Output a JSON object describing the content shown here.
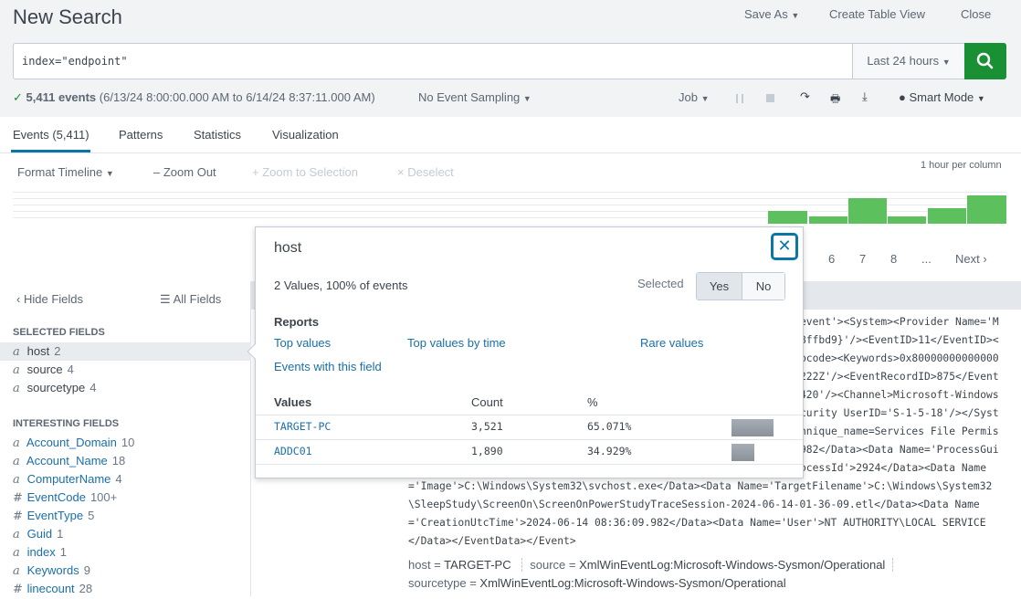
{
  "header": {
    "title": "New Search",
    "save_as": "Save As",
    "create_table_view": "Create Table View",
    "close": "Close"
  },
  "search": {
    "query": "index=\"endpoint\"",
    "time_range": "Last 24 hours",
    "search_icon": "magnifier-icon",
    "button_color": "#1a9035"
  },
  "status": {
    "check": "✓",
    "count": "5,411 events",
    "range": "(6/13/24 8:00:00.000 AM to 6/14/24 8:37:11.000 AM)",
    "sampling": "No Event Sampling",
    "job": "Job",
    "mode": "Smart Mode"
  },
  "tabs": [
    {
      "label": "Events (5,411)",
      "active": true
    },
    {
      "label": "Patterns"
    },
    {
      "label": "Statistics"
    },
    {
      "label": "Visualization"
    }
  ],
  "timeline": {
    "format": "Format Timeline",
    "zoom_out": "Zoom Out",
    "zoom_selection": "Zoom to Selection",
    "deselect": "Deselect",
    "scale": "1 hour per column",
    "bar_color": "#5cc05c",
    "relative_bars": [
      14,
      8,
      28,
      8,
      17,
      31
    ]
  },
  "pagination": {
    "pages": [
      "6",
      "7",
      "8",
      "..."
    ],
    "next": "Next"
  },
  "sidebar": {
    "hide_fields": "Hide Fields",
    "all_fields": "All Fields",
    "selected_title": "SELECTED FIELDS",
    "selected": [
      {
        "type": "a",
        "name": "host",
        "count": "2"
      },
      {
        "type": "a",
        "name": "source",
        "count": "4"
      },
      {
        "type": "a",
        "name": "sourcetype",
        "count": "4"
      }
    ],
    "interesting_title": "INTERESTING FIELDS",
    "interesting": [
      {
        "type": "a",
        "name": "Account_Domain",
        "count": "10"
      },
      {
        "type": "a",
        "name": "Account_Name",
        "count": "18"
      },
      {
        "type": "a",
        "name": "ComputerName",
        "count": "4"
      },
      {
        "type": "#",
        "name": "EventCode",
        "count": "100+"
      },
      {
        "type": "#",
        "name": "EventType",
        "count": "5"
      },
      {
        "type": "a",
        "name": "Guid",
        "count": "1"
      },
      {
        "type": "a",
        "name": "index",
        "count": "1"
      },
      {
        "type": "a",
        "name": "Keywords",
        "count": "9"
      },
      {
        "type": "#",
        "name": "linecount",
        "count": "28"
      }
    ]
  },
  "event": {
    "partial_lines": [
      "event'><System><Provider Name='M",
      "8ffbd9}'/><EventID>11</EventID><",
      "pcode><Keywords>0x80000000000000",
      "222Z'/><EventRecordID>875</Event",
      "420'/><Channel>Microsoft-Windows",
      "curity UserID='S-1-5-18'/></Syst",
      "hnique_name=Services File Permis",
      "982</Data><Data Name='ProcessGui",
      "ocessId'>2924</Data><Data Name"
    ],
    "lines": [
      "='Image'>C:\\Windows\\System32\\svchost.exe</Data><Data Name='TargetFilename'>C:\\Windows\\System32",
      "\\SleepStudy\\ScreenOn\\ScreenOnPowerStudyTraceSession-2024-06-14-01-36-09.etl</Data><Data Name",
      "='CreationUtcTime'>2024-06-14 08:36:09.982</Data><Data Name='User'>NT AUTHORITY\\LOCAL SERVICE",
      "</Data></EventData></Event>"
    ],
    "host_key": "host =",
    "host": "TARGET-PC",
    "source_key": "source =",
    "source": "XmlWinEventLog:Microsoft-Windows-Sysmon/Operational",
    "sourcetype_key": "sourcetype =",
    "sourcetype": "XmlWinEventLog:Microsoft-Windows-Sysmon/Operational"
  },
  "popup": {
    "title": "host",
    "summary": "2 Values, 100% of events",
    "selected_label": "Selected",
    "yes": "Yes",
    "no": "No",
    "selected_value": "Yes",
    "reports_title": "Reports",
    "reports": [
      "Top values",
      "Top values by time",
      "Rare values",
      "Events with this field"
    ],
    "columns": [
      "Values",
      "Count",
      "%"
    ],
    "rows": [
      {
        "value": "TARGET-PC",
        "count": "3,521",
        "pct": "65.071%",
        "fraction": 0.65071
      },
      {
        "value": "ADDC01",
        "count": "1,890",
        "pct": "34.929%",
        "fraction": 0.34929
      }
    ]
  }
}
